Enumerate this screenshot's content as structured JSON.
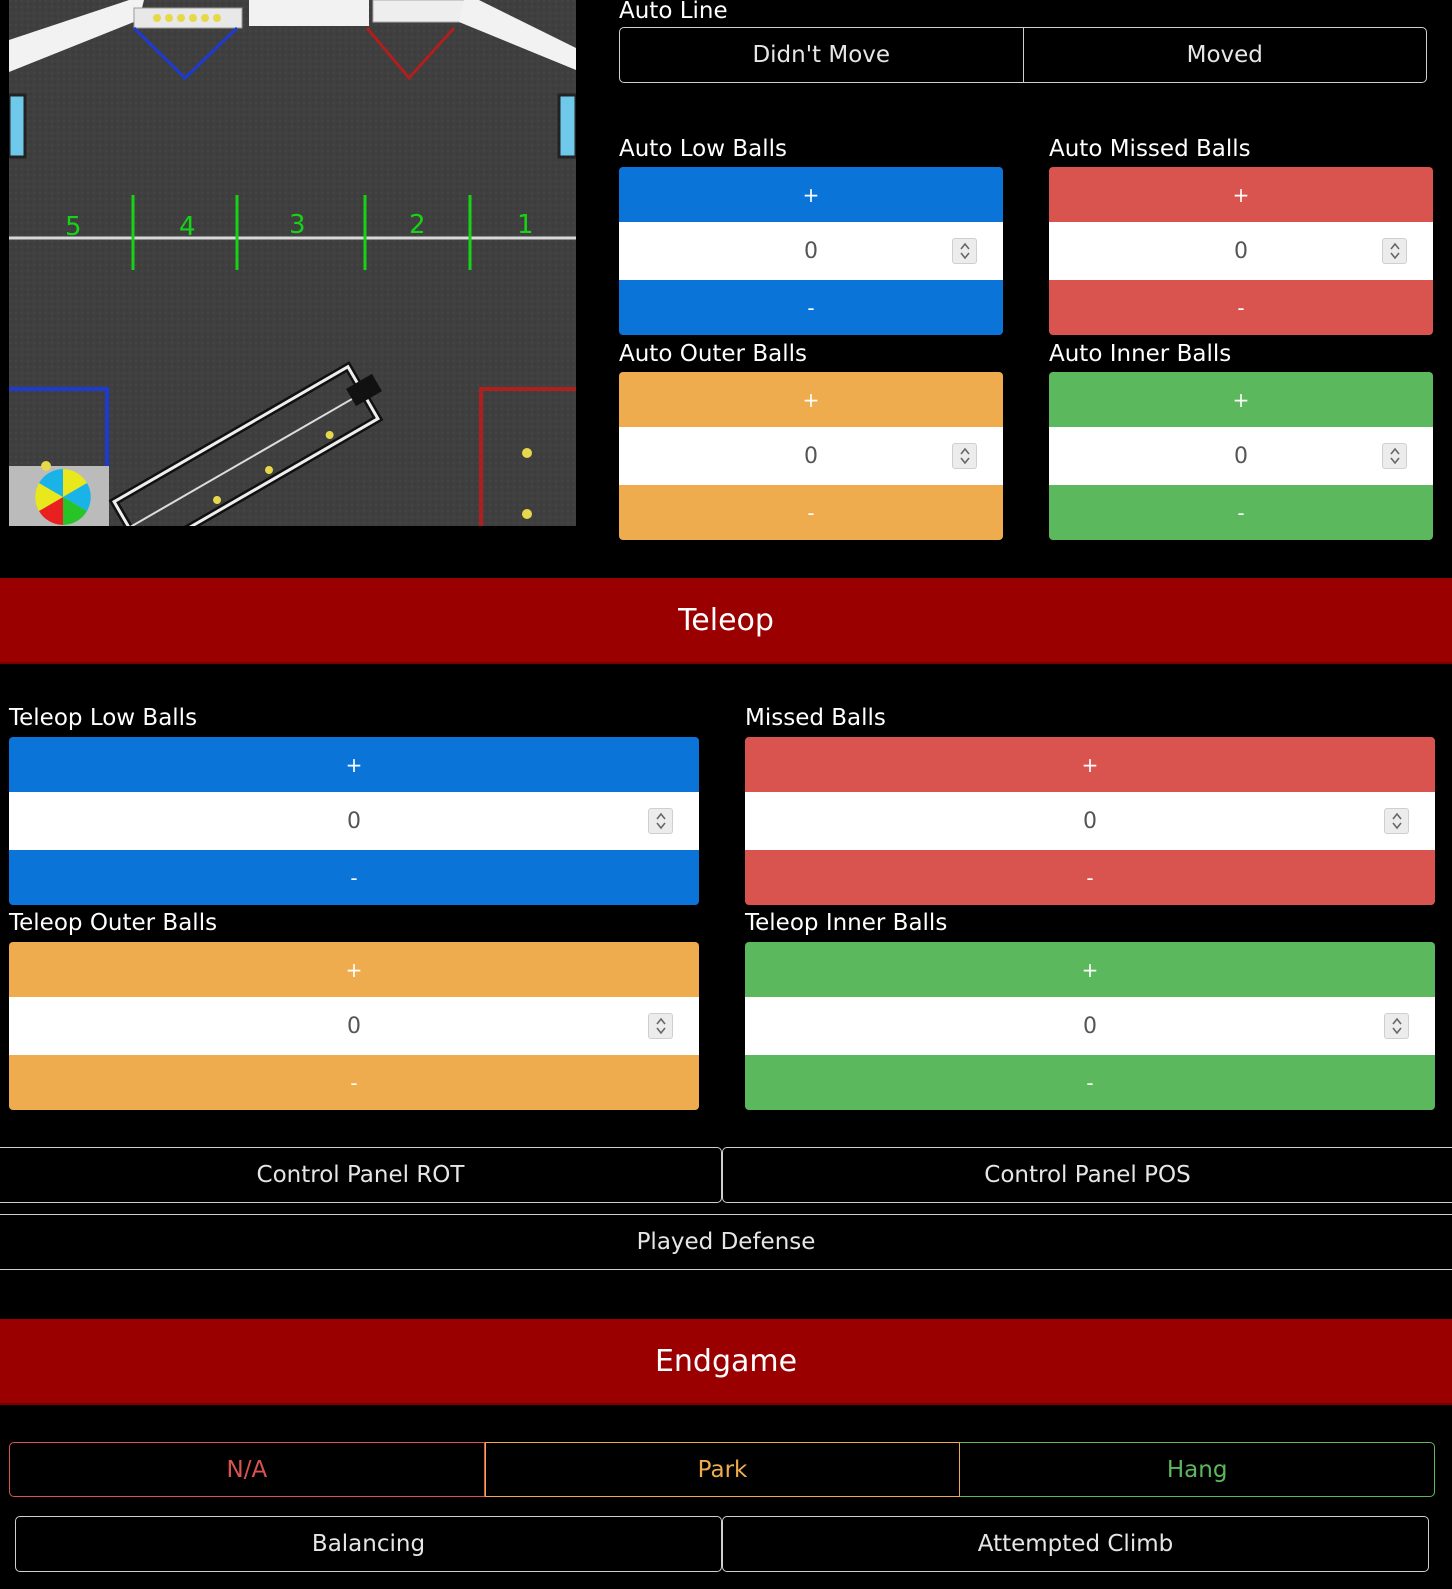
{
  "auto": {
    "line_label": "Auto Line",
    "line_options": [
      "Didn't Move",
      "Moved"
    ],
    "counters": [
      {
        "label": "Auto Low Balls",
        "value": "0",
        "plus": "+",
        "minus": "-"
      },
      {
        "label": "Auto Missed Balls",
        "value": "0",
        "plus": "+",
        "minus": "-"
      },
      {
        "label": "Auto Outer Balls",
        "value": "0",
        "plus": "+",
        "minus": "-"
      },
      {
        "label": "Auto Inner Balls",
        "value": "0",
        "plus": "+",
        "minus": "-"
      }
    ]
  },
  "field": {
    "zone_numbers": [
      "5",
      "4",
      "3",
      "2",
      "1"
    ]
  },
  "teleop": {
    "title": "Teleop",
    "counters": [
      {
        "label": "Teleop Low Balls",
        "value": "0",
        "plus": "+",
        "minus": "-"
      },
      {
        "label": "Missed Balls",
        "value": "0",
        "plus": "+",
        "minus": "-"
      },
      {
        "label": "Teleop Outer Balls",
        "value": "0",
        "plus": "+",
        "minus": "-"
      },
      {
        "label": "Teleop Inner Balls",
        "value": "0",
        "plus": "+",
        "minus": "-"
      }
    ],
    "control_panel_rot": "Control Panel ROT",
    "control_panel_pos": "Control Panel POS",
    "played_defense": "Played Defense"
  },
  "endgame": {
    "title": "Endgame",
    "options": [
      "N/A",
      "Park",
      "Hang"
    ],
    "balancing": "Balancing",
    "attempted_climb": "Attempted Climb"
  },
  "colors": {
    "blue": "#0a74d8",
    "red": "#d9534f",
    "orange": "#efac4e",
    "green": "#5cb85c",
    "banner": "#9a0000"
  }
}
